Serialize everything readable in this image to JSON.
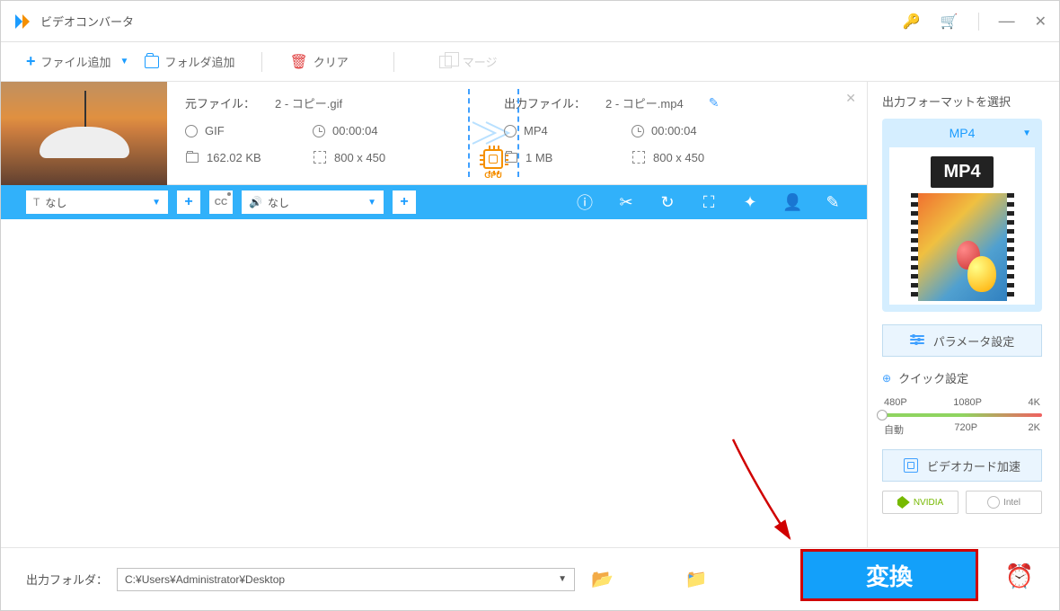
{
  "app": {
    "title": "ビデオコンバータ"
  },
  "toolbar": {
    "add_file": "ファイル追加",
    "add_folder": "フォルダ追加",
    "clear": "クリア",
    "merge": "マージ"
  },
  "file": {
    "source_label": "元ファイル：",
    "source_name": "2 - コピー.gif",
    "output_label": "出力ファイル：",
    "output_name": "2 - コピー.mp4",
    "src_format": "GIF",
    "src_duration": "00:00:04",
    "src_size": "162.02 KB",
    "src_dim": "800 x 450",
    "out_format": "MP4",
    "out_duration": "00:00:04",
    "out_size": "1 MB",
    "out_dim": "800 x 450",
    "gpu": "GPU"
  },
  "actionbar": {
    "subtitle_none": "なし",
    "audio_none": "なし",
    "cc": "CC"
  },
  "side": {
    "title": "出力フォーマットを選択",
    "format": "MP4",
    "badge": "MP4",
    "param": "パラメータ設定",
    "quick": "クイック設定",
    "res": {
      "p480": "480P",
      "p1080": "1080P",
      "p4k": "4K",
      "auto": "自動",
      "p720": "720P",
      "p2k": "2K"
    },
    "gpu_accel": "ビデオカード加速",
    "nvidia": "NVIDIA",
    "intel": "Intel"
  },
  "bottom": {
    "label": "出力フォルダ：",
    "path": "C:¥Users¥Administrator¥Desktop",
    "convert": "変換"
  }
}
